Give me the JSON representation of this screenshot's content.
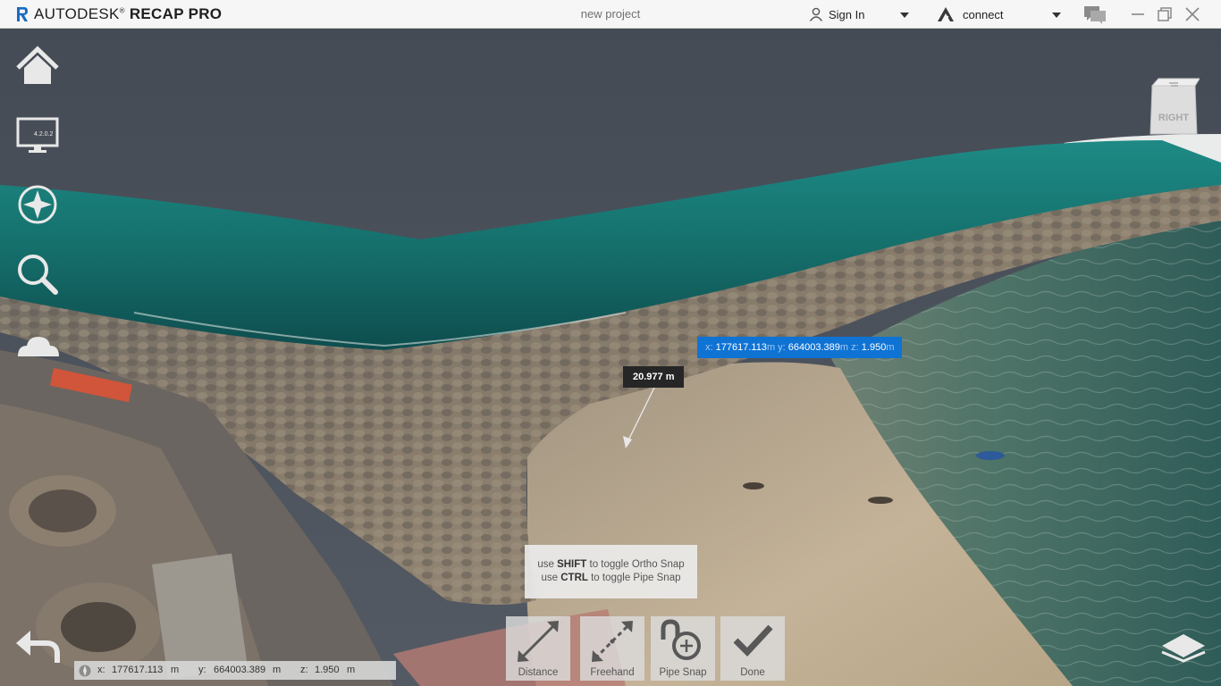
{
  "titlebar": {
    "brand": "AUTODESK",
    "brand_mark": "®",
    "product": "RECAP PRO",
    "project_name": "new project",
    "signin_label": "Sign In",
    "connect_label": "connect"
  },
  "left_toolbar": [
    {
      "icon": "home-icon"
    },
    {
      "icon": "display-settings-icon",
      "version": "4.2.0.2"
    },
    {
      "icon": "navigation-compass-icon"
    },
    {
      "icon": "search-icon"
    },
    {
      "icon": "cloud-icon"
    }
  ],
  "viewcube": {
    "face_label": "RIGHT"
  },
  "measurement": {
    "point": {
      "x_label": "x:",
      "x": "177617.113",
      "y_label": "y:",
      "y": "664003.389",
      "z_label": "z:",
      "z": "1.950",
      "unit": "m"
    },
    "distance": "20.977 m"
  },
  "hint": {
    "line1": {
      "pre": "use",
      "key": "SHIFT",
      "post": "to toggle Ortho Snap"
    },
    "line2": {
      "pre": "use",
      "key": "CTRL",
      "post": "to toggle Pipe Snap"
    }
  },
  "measure_tools": [
    {
      "label": "Distance",
      "icon": "distance-icon"
    },
    {
      "label": "Freehand",
      "icon": "freehand-icon"
    },
    {
      "label": "Pipe Snap",
      "icon": "pipe-snap-icon"
    },
    {
      "label": "Done",
      "icon": "checkmark-icon"
    }
  ],
  "status": {
    "x_label": "x:",
    "x": "177617.113",
    "x_unit": "m",
    "y_label": "y:",
    "y": "664003.389",
    "y_unit": "m",
    "z_label": "z:",
    "z": "1.950",
    "z_unit": "m"
  },
  "colors": {
    "accent": "#0f73d4",
    "sky": "#4a5058",
    "sea": "#1f7f80",
    "sand": "#bfae93"
  }
}
